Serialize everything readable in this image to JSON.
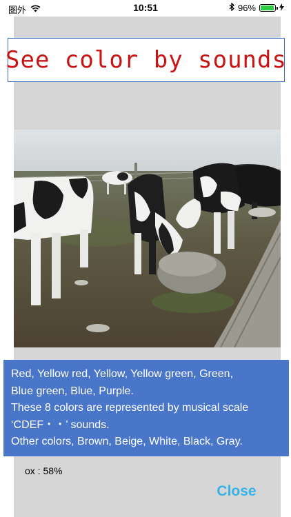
{
  "status_bar": {
    "carrier": "圏外",
    "time": "10:51",
    "battery_percent": "96%",
    "battery_level": 0.96,
    "battery_color": "#2ecc40"
  },
  "title": "See color by sounds",
  "photo": {
    "description_icon": "photo-image"
  },
  "info": {
    "line1": "Red, Yellow red, Yellow, Yellow green, Green,",
    "line2": "Blue green, Blue, Purple.",
    "line3": "These 8 colors are represented by musical scale",
    "line4": "‘CDEF・・’ sounds.",
    "line5": "Other colors, Brown, Beige, White, Black, Gray."
  },
  "ratio_text": "ox : 58%",
  "close_label": "Close",
  "colors": {
    "panel": "#d6d6d6",
    "title_text": "#c81414",
    "title_border": "#3a6bbf",
    "info_bg": "#4a76c9",
    "close": "#35b2e6"
  }
}
